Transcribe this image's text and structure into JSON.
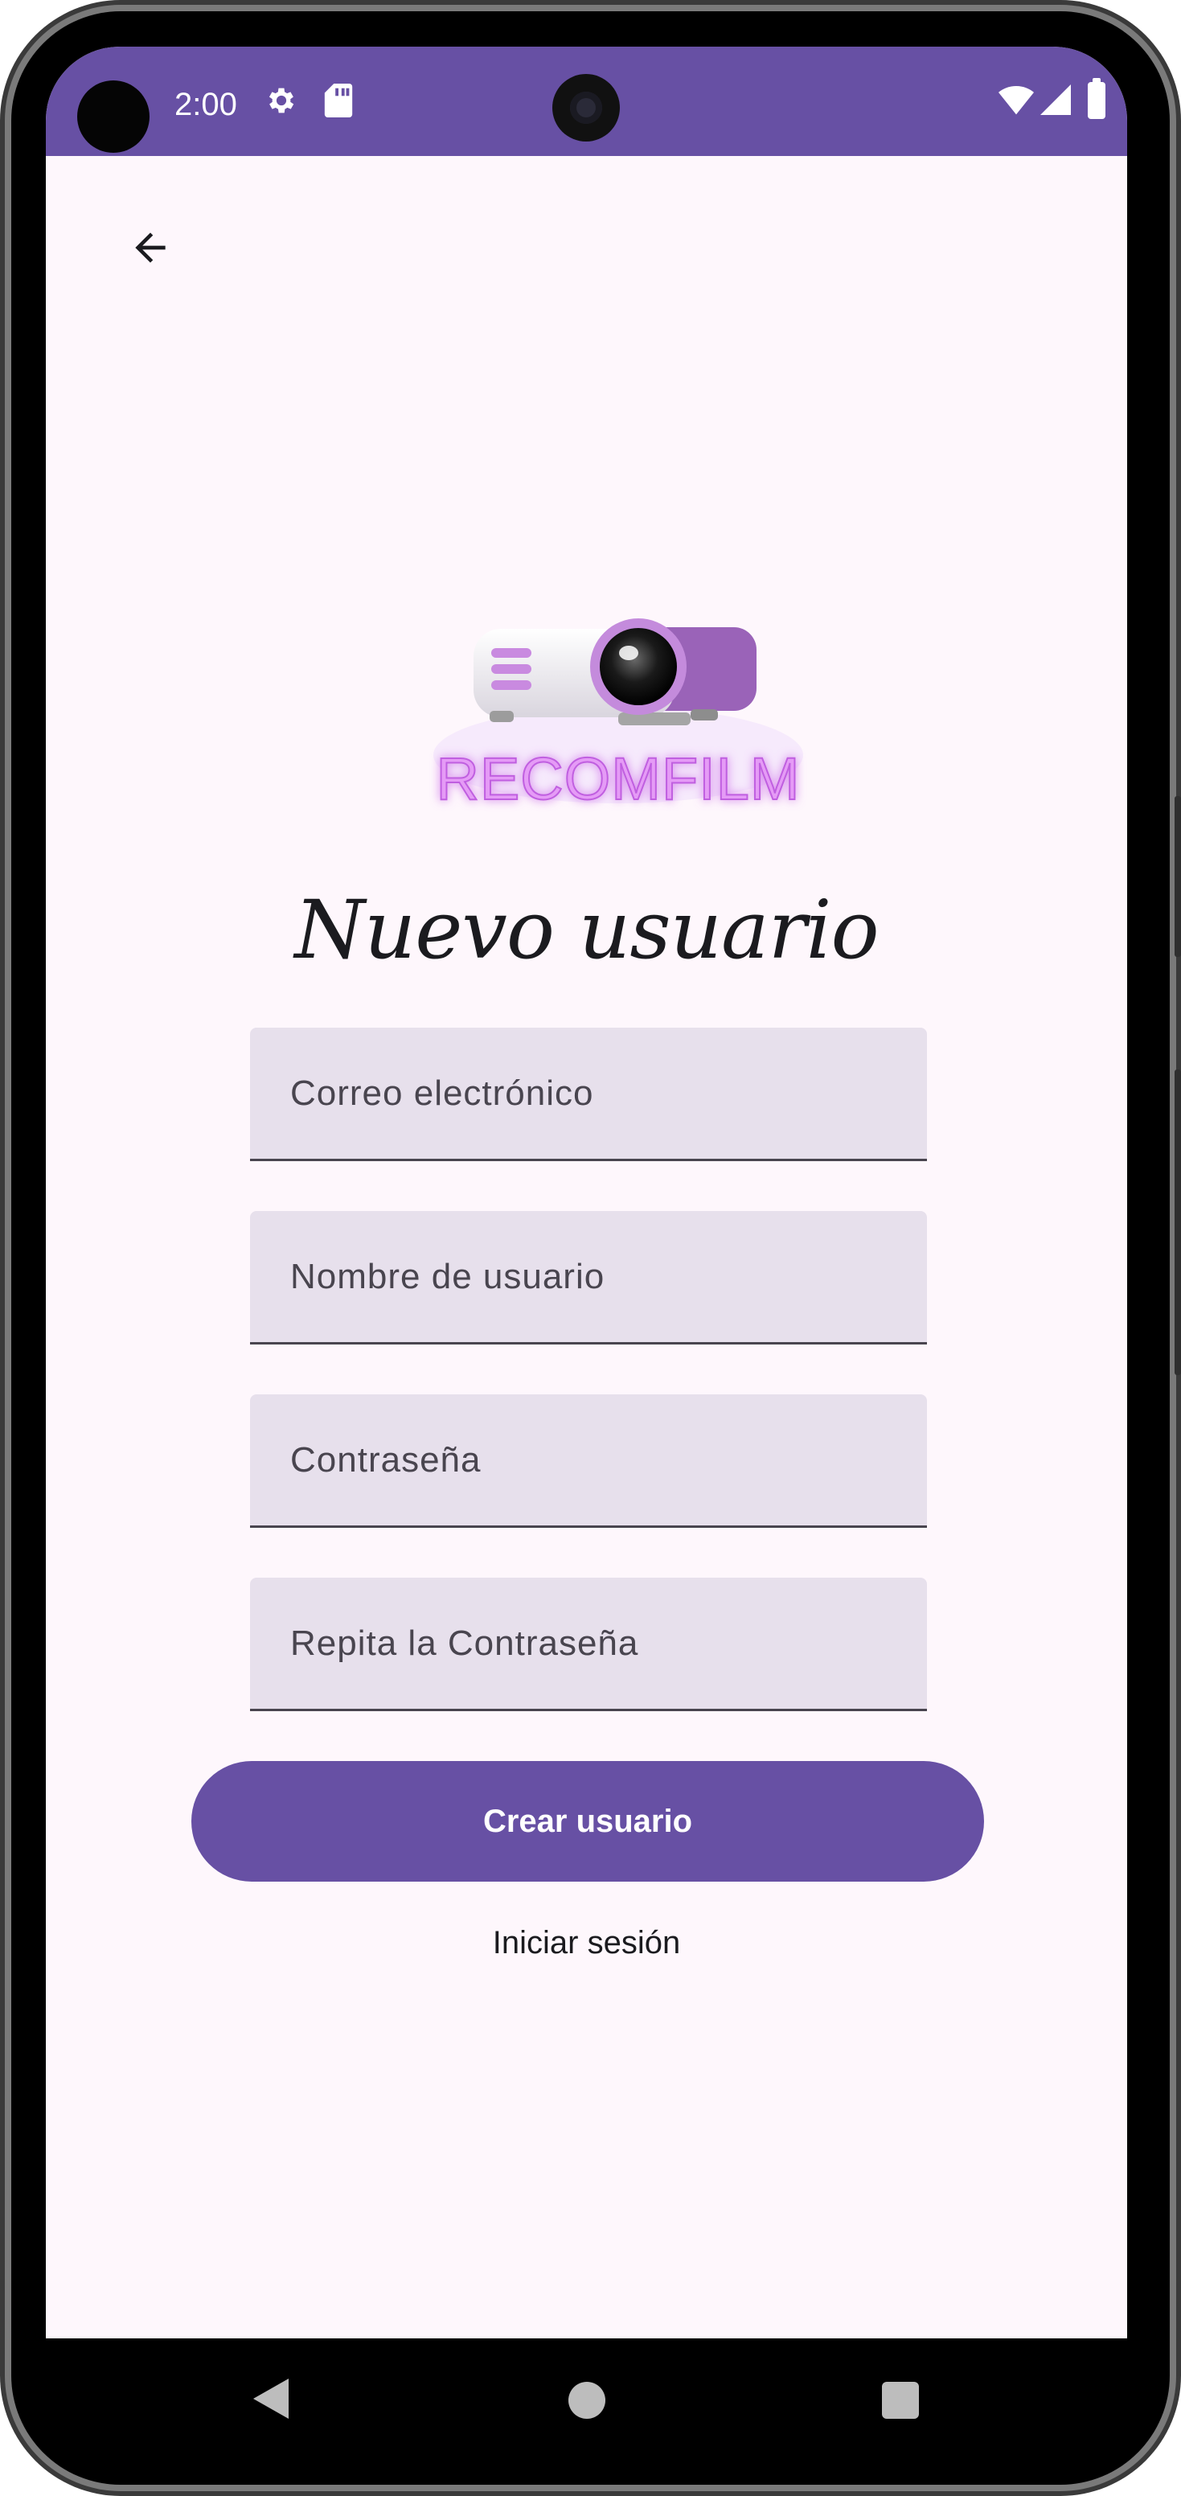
{
  "status_bar": {
    "time": "2:00",
    "icons": [
      "settings-icon",
      "sd-card-icon",
      "wifi-icon",
      "signal-icon",
      "battery-icon"
    ]
  },
  "toolbar": {
    "back_icon": "arrow-back-icon"
  },
  "logo": {
    "text": "RECOMFILM",
    "icon": "projector-logo"
  },
  "form": {
    "title": "Nuevo usuario",
    "email_placeholder": "Correo electrónico",
    "username_placeholder": "Nombre de usuario",
    "password_placeholder": "Contraseña",
    "repeat_password_placeholder": "Repita la Contraseña",
    "submit_label": "Crear usuario",
    "login_link": "Iniciar sesión"
  },
  "colors": {
    "primary": "#6750a4",
    "background": "#fef7fc",
    "field_fill": "#e7e0ec",
    "text": "#1b1b1f",
    "logo_neon": "#d98cf0"
  },
  "nav_bar": {
    "icons": [
      "nav-back-icon",
      "nav-home-icon",
      "nav-recents-icon"
    ]
  }
}
